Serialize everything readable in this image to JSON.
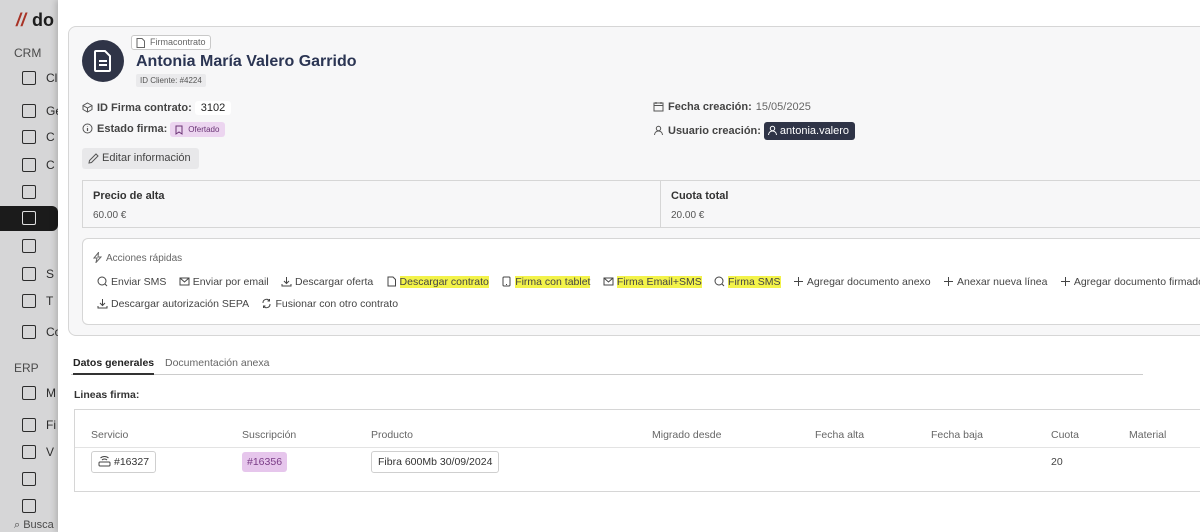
{
  "sidebar": {
    "logo_mark": "//",
    "logo_rest": "do",
    "sections": [
      "CRM",
      "ERP"
    ],
    "items": [
      {
        "label": "Cl",
        "icon": "list-icon"
      },
      {
        "label": "Ge",
        "icon": "document-icon"
      },
      {
        "label": "C",
        "icon": "plus-document-icon"
      },
      {
        "label": "C",
        "icon": "edit-document-icon"
      },
      {
        "label": "",
        "icon": "copy-icon"
      },
      {
        "label": "",
        "icon": "contract-icon"
      },
      {
        "label": "",
        "icon": "signature-icon"
      },
      {
        "label": "S",
        "icon": "mail-icon"
      },
      {
        "label": "T",
        "icon": "list-document-icon"
      },
      {
        "label": "Co",
        "icon": "briefcase-icon"
      },
      {
        "label": "M",
        "icon": "inbox-icon"
      },
      {
        "label": "Fi",
        "icon": "chart-icon"
      },
      {
        "label": "V",
        "icon": "box-icon"
      },
      {
        "label": "",
        "icon": "recycle-icon"
      },
      {
        "label": "",
        "icon": "note-icon"
      }
    ],
    "search_label": "Busca"
  },
  "header": {
    "doc_type": "Firmacontrato",
    "client_name": "Antonia María Valero Garrido",
    "client_id": "ID Cliente: #4224"
  },
  "fields": {
    "id_label": "ID Firma contrato:",
    "id_value": "3102",
    "state_label": "Estado firma:",
    "state_value": "Ofertado",
    "created_label": "Fecha creación:",
    "created_value": "15/05/2025",
    "user_label": "Usuario creación:",
    "user_value": "antonia.valero"
  },
  "edit_button": "Editar información",
  "prices": {
    "alta_label": "Precio de alta",
    "alta_value": "60.00 €",
    "cuota_label": "Cuota total",
    "cuota_value": "20.00 €"
  },
  "quick_actions": {
    "title": "Acciones rápidas",
    "row1": [
      {
        "label": "Enviar SMS",
        "icon": "chat-icon",
        "highlighted": false
      },
      {
        "label": "Enviar por email",
        "icon": "mail-icon",
        "highlighted": false
      },
      {
        "label": "Descargar oferta",
        "icon": "download-icon",
        "highlighted": false
      },
      {
        "label": "Descargar contrato",
        "icon": "file-icon",
        "highlighted": true
      },
      {
        "label": "Firma con tablet",
        "icon": "tablet-icon",
        "highlighted": true
      },
      {
        "label": "Firma Email+SMS",
        "icon": "mail-icon",
        "highlighted": true
      },
      {
        "label": "Firma SMS",
        "icon": "chat-icon",
        "highlighted": true
      },
      {
        "label": "Agregar documento anexo",
        "icon": "plus-icon",
        "highlighted": false
      },
      {
        "label": "Anexar nueva línea",
        "icon": "plus-icon",
        "highlighted": false
      },
      {
        "label": "Agregar documento firmado",
        "icon": "plus-icon",
        "highlighted": false
      }
    ],
    "row2": [
      {
        "label": "Descargar autorización SEPA",
        "icon": "download-icon"
      },
      {
        "label": "Fusionar con otro contrato",
        "icon": "merge-icon"
      }
    ]
  },
  "tabs": [
    "Datos generales",
    "Documentación anexa"
  ],
  "lines": {
    "title": "Lineas firma:",
    "columns": [
      "Servicio",
      "Suscripción",
      "Producto",
      "Migrado desde",
      "Fecha alta",
      "Fecha baja",
      "Cuota",
      "Material"
    ],
    "rows": [
      {
        "servicio": "#16327",
        "suscripcion": "#16356",
        "producto": "Fibra 600Mb 30/09/2024",
        "migrado": "",
        "fecha_alta": "",
        "fecha_baja": "",
        "cuota": "20",
        "material": ""
      }
    ]
  },
  "colors": {
    "highlight": "#f3f34a",
    "dark_chip": "#2f3447",
    "purple_chip": "#ecd5f0"
  }
}
